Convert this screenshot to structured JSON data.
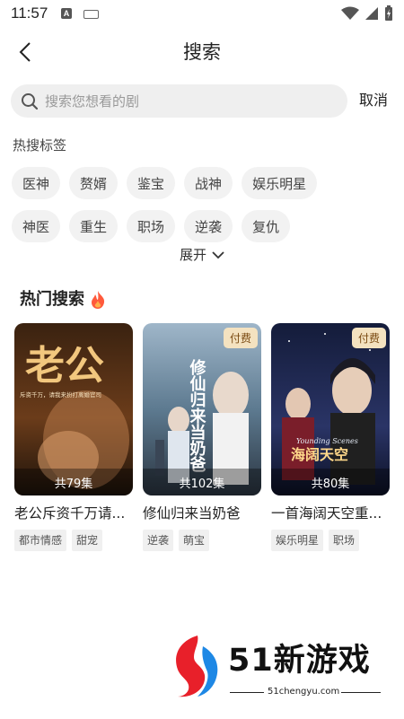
{
  "status_bar": {
    "time": "11:57",
    "a_badge": "A"
  },
  "header": {
    "title": "搜索"
  },
  "search": {
    "placeholder": "搜索您想看的剧",
    "cancel_label": "取消"
  },
  "hot_tags": {
    "label": "热搜标签",
    "rows": [
      [
        "医神",
        "赘婿",
        "鉴宝",
        "战神",
        "娱乐明星"
      ],
      [
        "神医",
        "重生",
        "职场",
        "逆袭",
        "复仇"
      ]
    ],
    "expand_label": "展开"
  },
  "hot_search": {
    "title": "热门搜索",
    "items": [
      {
        "title": "老公斥资千万请...",
        "episodes": "共79集",
        "paid": false,
        "badge": "",
        "tags": [
          "都市情感",
          "甜宠"
        ],
        "poster_text": "老公",
        "poster_subtext": "斥资千万，请我来扮打离婚官司"
      },
      {
        "title": "修仙归来当奶爸",
        "episodes": "共102集",
        "paid": true,
        "badge": "付费",
        "tags": [
          "逆袭",
          "萌宝"
        ],
        "poster_text": "修仙归来当奶爸",
        "poster_subtext": ""
      },
      {
        "title": "一首海阔天空重...",
        "episodes": "共80集",
        "paid": true,
        "badge": "付费",
        "tags": [
          "娱乐明星",
          "职场"
        ],
        "poster_text": "海阔天空",
        "poster_subtext": "Younding Scenes"
      }
    ]
  },
  "watermark": {
    "brand": "51新游戏",
    "url": "51chengyu.com"
  },
  "colors": {
    "badge_bg": "#f4e2c0",
    "badge_text": "#7a4a12",
    "tag_bg": "#f2f2f2",
    "flame": "#ff5a3c",
    "wm_red": "#e8202a",
    "wm_blue": "#1e88e5"
  }
}
